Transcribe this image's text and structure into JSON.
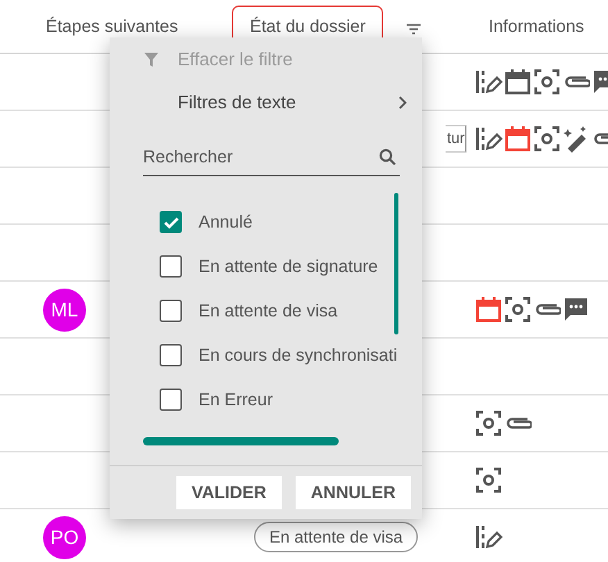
{
  "table": {
    "columns": [
      {
        "label": "Étapes suivantes",
        "highlighted": false
      },
      {
        "label": "État du dossier",
        "highlighted": true,
        "filter": true
      },
      {
        "label": "Informations",
        "highlighted": false
      }
    ],
    "rows": [
      {
        "icons": [
          {
            "kind": "signature"
          },
          {
            "kind": "calendar",
            "alert": false
          },
          {
            "kind": "focus"
          },
          {
            "kind": "clip"
          },
          {
            "kind": "chat"
          }
        ]
      },
      {
        "status": "tur",
        "status_clipped": true,
        "icons": [
          {
            "kind": "signature"
          },
          {
            "kind": "calendar",
            "alert": true
          },
          {
            "kind": "focus"
          },
          {
            "kind": "magic"
          },
          {
            "kind": "clip"
          }
        ]
      },
      {},
      {},
      {
        "avatar": "ML",
        "icons": [
          {
            "kind": "calendar",
            "alert": true
          },
          {
            "kind": "focus"
          },
          {
            "kind": "clip"
          },
          {
            "kind": "chat"
          }
        ]
      },
      {},
      {
        "icons": [
          {
            "kind": "focus"
          },
          {
            "kind": "clip"
          }
        ]
      },
      {
        "icons": [
          {
            "kind": "focus"
          }
        ]
      },
      {
        "avatar": "PO",
        "status": "En attente de visa",
        "status_clipped": false,
        "icons": [
          {
            "kind": "signature"
          }
        ]
      }
    ]
  },
  "filter_menu": {
    "clear_filter": {
      "label": "Effacer le filtre",
      "disabled": true
    },
    "submenu": {
      "label": "Filtres de texte"
    },
    "search": {
      "placeholder": "Rechercher"
    },
    "options": [
      {
        "label": "Annulé",
        "checked": true
      },
      {
        "label": "En attente de signature",
        "checked": false
      },
      {
        "label": "En attente de visa",
        "checked": false
      },
      {
        "label": "En cours de synchronisati",
        "checked": false
      },
      {
        "label": "En Erreur",
        "checked": false
      }
    ],
    "buttons": [
      "VALIDER",
      "ANNULER"
    ]
  }
}
